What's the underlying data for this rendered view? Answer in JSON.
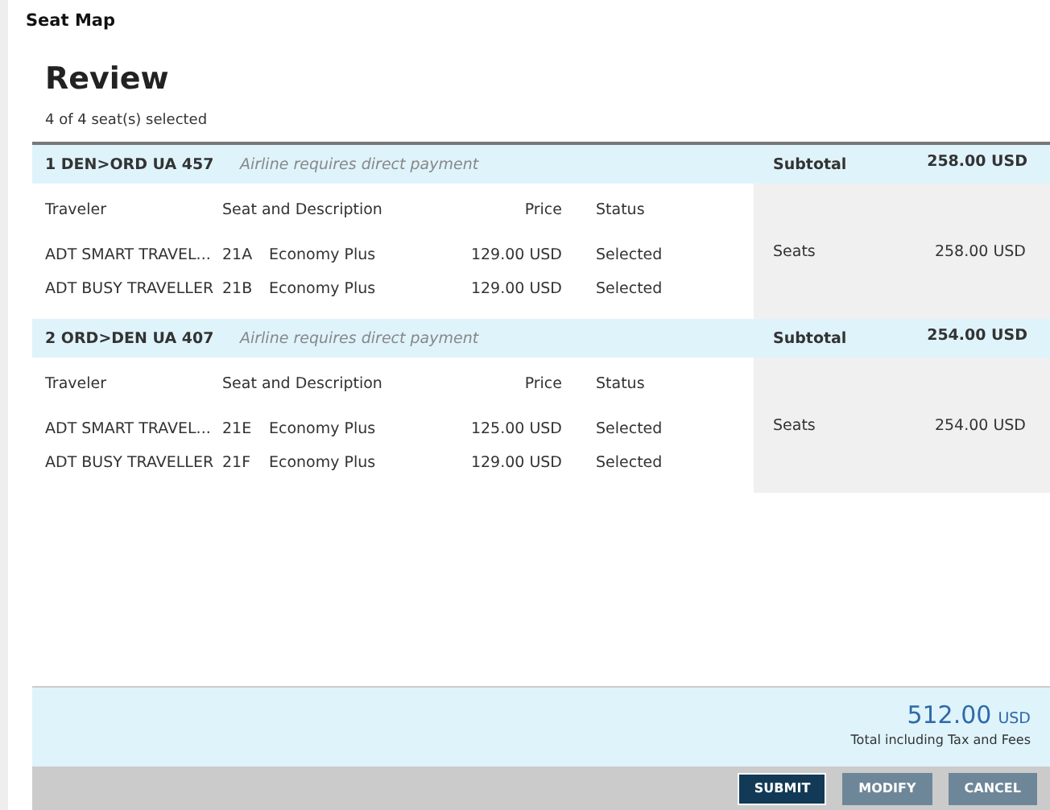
{
  "title": "Seat Map",
  "heading": "Review",
  "selection_summary": "4 of 4 seat(s) selected",
  "segments": [
    {
      "label": "1 DEN>ORD UA 457",
      "note": "Airline requires direct payment",
      "subtotal_label": "Subtotal",
      "subtotal": "258.00 USD",
      "columns": [
        "Traveler",
        "Seat and Description",
        "Price",
        "Status"
      ],
      "rows": [
        {
          "traveler": "ADT SMART TRAVEL...",
          "seat": "21A",
          "description": "Economy Plus",
          "price": "129.00 USD",
          "status": "Selected"
        },
        {
          "traveler": "ADT BUSY TRAVELLER",
          "seat": "21B",
          "description": "Economy Plus",
          "price": "129.00 USD",
          "status": "Selected"
        }
      ],
      "summary": {
        "label": "Seats",
        "amount": "258.00 USD"
      }
    },
    {
      "label": "2 ORD>DEN UA 407",
      "note": "Airline requires direct payment",
      "subtotal_label": "Subtotal",
      "subtotal": "254.00 USD",
      "columns": [
        "Traveler",
        "Seat and Description",
        "Price",
        "Status"
      ],
      "rows": [
        {
          "traveler": "ADT SMART TRAVEL...",
          "seat": "21E",
          "description": "Economy Plus",
          "price": "125.00 USD",
          "status": "Selected"
        },
        {
          "traveler": "ADT BUSY TRAVELLER",
          "seat": "21F",
          "description": "Economy Plus",
          "price": "129.00 USD",
          "status": "Selected"
        }
      ],
      "summary": {
        "label": "Seats",
        "amount": "254.00 USD"
      }
    }
  ],
  "total": {
    "amount": "512.00",
    "currency": "USD",
    "caption": "Total including Tax and Fees"
  },
  "buttons": [
    {
      "label": "SUBMIT",
      "kind": "primary"
    },
    {
      "label": "MODIFY",
      "kind": "secondary"
    },
    {
      "label": "CANCEL",
      "kind": "secondary"
    }
  ]
}
